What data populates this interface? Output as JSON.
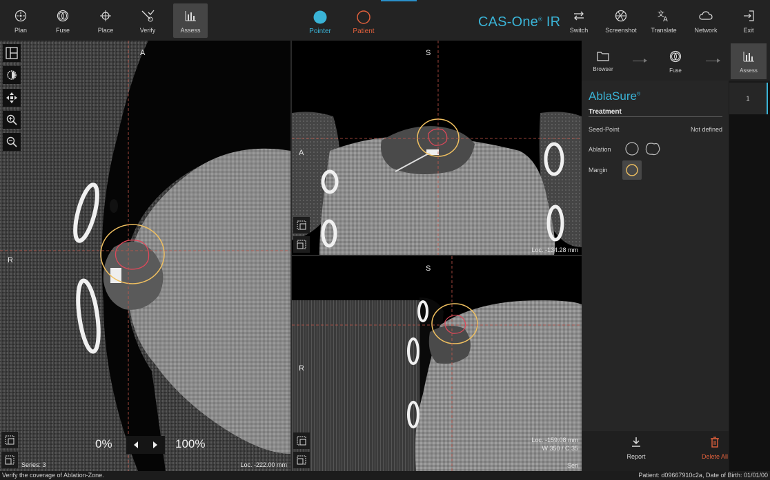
{
  "toolbar": {
    "left": [
      {
        "label": "Plan",
        "icon": "crosshair-circle-icon"
      },
      {
        "label": "Fuse",
        "icon": "fuse-rings-icon"
      },
      {
        "label": "Place",
        "icon": "target-cross-icon"
      },
      {
        "label": "Verify",
        "icon": "verify-needle-icon"
      },
      {
        "label": "Assess",
        "icon": "bar-chart-icon",
        "active": true
      }
    ],
    "pointer_label": "Pointer",
    "patient_label": "Patient",
    "brand": "CAS-One",
    "brand_suffix": "IR",
    "brand_mark": "®",
    "right": [
      {
        "label": "Switch",
        "icon": "switch-arrows-icon"
      },
      {
        "label": "Screenshot",
        "icon": "aperture-icon"
      },
      {
        "label": "Translate",
        "icon": "translate-icon"
      },
      {
        "label": "Network",
        "icon": "cloud-icon"
      },
      {
        "label": "Exit",
        "icon": "exit-icon"
      }
    ],
    "colors": {
      "pointer": "#3ab3d6",
      "patient": "#e0603c",
      "brand": "#3ab3d6"
    }
  },
  "viewports": {
    "axial_left": {
      "orient_top": "A",
      "orient_left": "R",
      "series": "Series: 3",
      "loc": "Loc. -222.00 mm"
    },
    "top_right": {
      "orient_top": "S",
      "orient_left": "A",
      "loc": "Loc. -134.28 mm"
    },
    "bottom_right": {
      "orient_top": "S",
      "orient_left": "R",
      "loc": "Loc. -159.08 mm",
      "window": "W 350 / C 35",
      "series": "Seri"
    }
  },
  "zoom": {
    "min": "0%",
    "max": "100%"
  },
  "workflow": {
    "steps": [
      {
        "label": "Browser",
        "icon": "folder-icon"
      },
      {
        "label": "Fuse",
        "icon": "fuse-rings-icon"
      },
      {
        "label": "Assess",
        "icon": "bar-chart-icon",
        "active": true
      }
    ],
    "list_item": "1"
  },
  "panel": {
    "app": "AblaSure",
    "app_mark": "®",
    "section": "Treatment",
    "seed_point_label": "Seed-Point",
    "seed_point_value": "Not defined",
    "ablation_label": "Ablation",
    "margin_label": "Margin",
    "colors": {
      "ablation": "#e0485a",
      "margin": "#f0c060"
    }
  },
  "actions": {
    "report": "Report",
    "delete_all": "Delete All",
    "colors": {
      "delete": "#e0603c"
    }
  },
  "status": {
    "left": "Verify the coverage of Ablation-Zone.",
    "right": "Patient: d09667910c2a, Date of Birth: 01/01/00"
  }
}
